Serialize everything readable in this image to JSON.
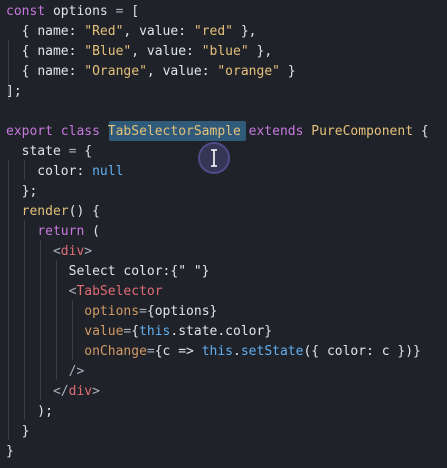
{
  "editor": {
    "language": "javascript-react",
    "lines": [
      [
        [
          "const",
          "#c678dd"
        ],
        [
          " options ",
          "#dfe5ec"
        ],
        [
          "=",
          "#abb2bf"
        ],
        [
          " [",
          "#dfe5ec"
        ]
      ],
      [
        [
          "  { ",
          "#dfe5ec"
        ],
        [
          "name",
          "#dfe5ec"
        ],
        [
          ": ",
          "#dfe5ec"
        ],
        [
          "\"Red\"",
          "#e5c07b"
        ],
        [
          ", ",
          "#dfe5ec"
        ],
        [
          "value",
          "#dfe5ec"
        ],
        [
          ": ",
          "#dfe5ec"
        ],
        [
          "\"red\"",
          "#e5c07b"
        ],
        [
          " },",
          "#dfe5ec"
        ]
      ],
      [
        [
          "  { ",
          "#dfe5ec"
        ],
        [
          "name",
          "#dfe5ec"
        ],
        [
          ": ",
          "#dfe5ec"
        ],
        [
          "\"Blue\"",
          "#e5c07b"
        ],
        [
          ", ",
          "#dfe5ec"
        ],
        [
          "value",
          "#dfe5ec"
        ],
        [
          ": ",
          "#dfe5ec"
        ],
        [
          "\"blue\"",
          "#e5c07b"
        ],
        [
          " },",
          "#dfe5ec"
        ]
      ],
      [
        [
          "  { ",
          "#dfe5ec"
        ],
        [
          "name",
          "#dfe5ec"
        ],
        [
          ": ",
          "#dfe5ec"
        ],
        [
          "\"Orange\"",
          "#e5c07b"
        ],
        [
          ", ",
          "#dfe5ec"
        ],
        [
          "value",
          "#dfe5ec"
        ],
        [
          ": ",
          "#dfe5ec"
        ],
        [
          "\"orange\"",
          "#e5c07b"
        ],
        [
          " }",
          "#dfe5ec"
        ]
      ],
      [
        [
          "];",
          "#dfe5ec"
        ]
      ],
      [
        [
          "",
          "#dfe5ec"
        ]
      ],
      [
        [
          "export",
          "#c678dd"
        ],
        [
          " ",
          "#dfe5ec"
        ],
        [
          "class",
          "#c678dd"
        ],
        [
          " ",
          "#dfe5ec"
        ],
        [
          "TabSelectorSample",
          "#e5c07b"
        ],
        [
          " ",
          "#dfe5ec"
        ],
        [
          "extends",
          "#c678dd"
        ],
        [
          " ",
          "#dfe5ec"
        ],
        [
          "PureComponent",
          "#e5c07b"
        ],
        [
          " {",
          "#dfe5ec"
        ]
      ],
      [
        [
          "  state ",
          "#dfe5ec"
        ],
        [
          "=",
          "#abb2bf"
        ],
        [
          " {",
          "#dfe5ec"
        ]
      ],
      [
        [
          "    color",
          "#dfe5ec"
        ],
        [
          ": ",
          "#dfe5ec"
        ],
        [
          "null",
          "#61afef"
        ]
      ],
      [
        [
          "  };",
          "#dfe5ec"
        ]
      ],
      [
        [
          "  render",
          "#e5c07b"
        ],
        [
          "() {",
          "#dfe5ec"
        ]
      ],
      [
        [
          "    ",
          "#dfe5ec"
        ],
        [
          "return",
          "#c678dd"
        ],
        [
          " (",
          "#dfe5ec"
        ]
      ],
      [
        [
          "      <",
          "#abb2bf"
        ],
        [
          "div",
          "#e06c75"
        ],
        [
          ">",
          "#abb2bf"
        ]
      ],
      [
        [
          "        Select color:",
          "#dfe5ec"
        ],
        [
          "{\" \"}",
          "#dfe5ec"
        ]
      ],
      [
        [
          "        <",
          "#abb2bf"
        ],
        [
          "TabSelector",
          "#e06c75"
        ]
      ],
      [
        [
          "          ",
          "#dfe5ec"
        ],
        [
          "options",
          "#d19a66"
        ],
        [
          "=",
          "#abb2bf"
        ],
        [
          "{options}",
          "#dfe5ec"
        ]
      ],
      [
        [
          "          ",
          "#dfe5ec"
        ],
        [
          "value",
          "#d19a66"
        ],
        [
          "=",
          "#abb2bf"
        ],
        [
          "{",
          "#dfe5ec"
        ],
        [
          "this",
          "#61afef"
        ],
        [
          ".state.color}",
          "#dfe5ec"
        ]
      ],
      [
        [
          "          ",
          "#dfe5ec"
        ],
        [
          "onChange",
          "#d19a66"
        ],
        [
          "=",
          "#abb2bf"
        ],
        [
          "{c => ",
          "#dfe5ec"
        ],
        [
          "this",
          "#61afef"
        ],
        [
          ".",
          "#dfe5ec"
        ],
        [
          "setState",
          "#61afef"
        ],
        [
          "({ color: c })}",
          "#dfe5ec"
        ]
      ],
      [
        [
          "        />",
          "#abb2bf"
        ]
      ],
      [
        [
          "      </",
          "#abb2bf"
        ],
        [
          "div",
          "#e06c75"
        ],
        [
          ">",
          "#abb2bf"
        ]
      ],
      [
        [
          "    );",
          "#dfe5ec"
        ]
      ],
      [
        [
          "  }",
          "#dfe5ec"
        ]
      ],
      [
        [
          "}",
          "#dfe5ec"
        ]
      ]
    ]
  },
  "selection": {
    "text": "TabSelectorSample",
    "color": "#2f5a7a"
  },
  "cursor": {
    "icon": "text-cursor-icon",
    "ring_color": "#7b6fdc"
  },
  "colors": {
    "background": "#1f2228",
    "keyword": "#c678dd",
    "string": "#e5c07b",
    "class_name": "#e5c07b",
    "jsx_tag": "#e06c75",
    "jsx_attr": "#d19a66",
    "builtin": "#61afef",
    "plain": "#dfe5ec"
  }
}
